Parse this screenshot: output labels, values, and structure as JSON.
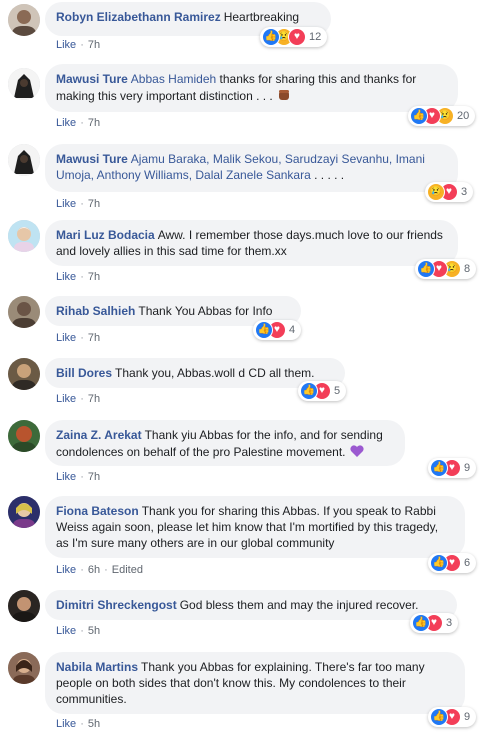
{
  "actions": {
    "like_label": "Like",
    "edited_label": "Edited"
  },
  "comments": [
    {
      "author": "Robyn Elizabethann Ramirez",
      "text": "Heartbreaking",
      "time": "7h",
      "reactions": [
        "like",
        "sad",
        "love"
      ],
      "reaction_count": "12",
      "avatar_color": "#8a6a55"
    },
    {
      "author": "Mawusi Ture",
      "tags": "Abbas Hamideh",
      "text": "thanks for sharing this and thanks for making this very important distinction . . .",
      "emoji": "raised-fist-icon",
      "time": "7h",
      "reactions": [
        "like",
        "love",
        "sad"
      ],
      "reaction_count": "20",
      "avatar_color": "#2a2a2a"
    },
    {
      "author": "Mawusi Ture",
      "tags": "Ajamu Baraka, Malik Sekou, Sarudzayi Sevanhu, Imani Umoja, Anthony Williams, Dalal Zanele Sankara",
      "text": ". . . . .",
      "time": "7h",
      "reactions": [
        "sad",
        "love"
      ],
      "reaction_count": "3",
      "avatar_color": "#2a2a2a"
    },
    {
      "author": "Mari Luz Bodacia",
      "text": "Aww. I remember those days.much love to our friends and lovely allies in this sad time for them.xx",
      "time": "7h",
      "reactions": [
        "like",
        "love",
        "sad"
      ],
      "reaction_count": "8",
      "avatar_color": "#6fb7d8"
    },
    {
      "author": "Rihab Salhieh",
      "text": "Thank You Abbas for Info",
      "time": "7h",
      "reactions": [
        "like",
        "love"
      ],
      "reaction_count": "4",
      "avatar_color": "#7a6a5a"
    },
    {
      "author": "Bill Dores",
      "text": "Thank you, Abbas.woll d CD all them.",
      "time": "7h",
      "reactions": [
        "like",
        "love"
      ],
      "reaction_count": "5",
      "avatar_color": "#5a4a3a"
    },
    {
      "author": "Zaina Z. Arekat",
      "text": "Thank yiu Abbas for the info, and for sending condolences on behalf of the pro Palestine movement.",
      "emoji": "purple-heart-icon",
      "time": "7h",
      "reactions": [
        "like",
        "love"
      ],
      "reaction_count": "9",
      "avatar_color": "#b05a3a"
    },
    {
      "author": "Fiona Bateson",
      "text": "Thank you for sharing this Abbas. If you speak to Rabbi Weiss again soon, please let him know that I'm mortified by this tragedy, as I'm sure many others are in our global community",
      "time": "6h",
      "edited": true,
      "reactions": [
        "like",
        "love"
      ],
      "reaction_count": "6",
      "avatar_color": "#3a3a6a"
    },
    {
      "author": "Dimitri Shreckengost",
      "text": "God bless them and may the injured recover.",
      "time": "5h",
      "reactions": [
        "like",
        "love"
      ],
      "reaction_count": "3",
      "avatar_color": "#3a2e2a"
    },
    {
      "author": "Nabila Martins",
      "text": "Thank you Abbas for explaining. There's far too many people on both sides that don't know this. My condolences to their communities.",
      "time": "5h",
      "reactions": [
        "like",
        "love"
      ],
      "reaction_count": "9",
      "avatar_color": "#6a4a3a"
    }
  ]
}
